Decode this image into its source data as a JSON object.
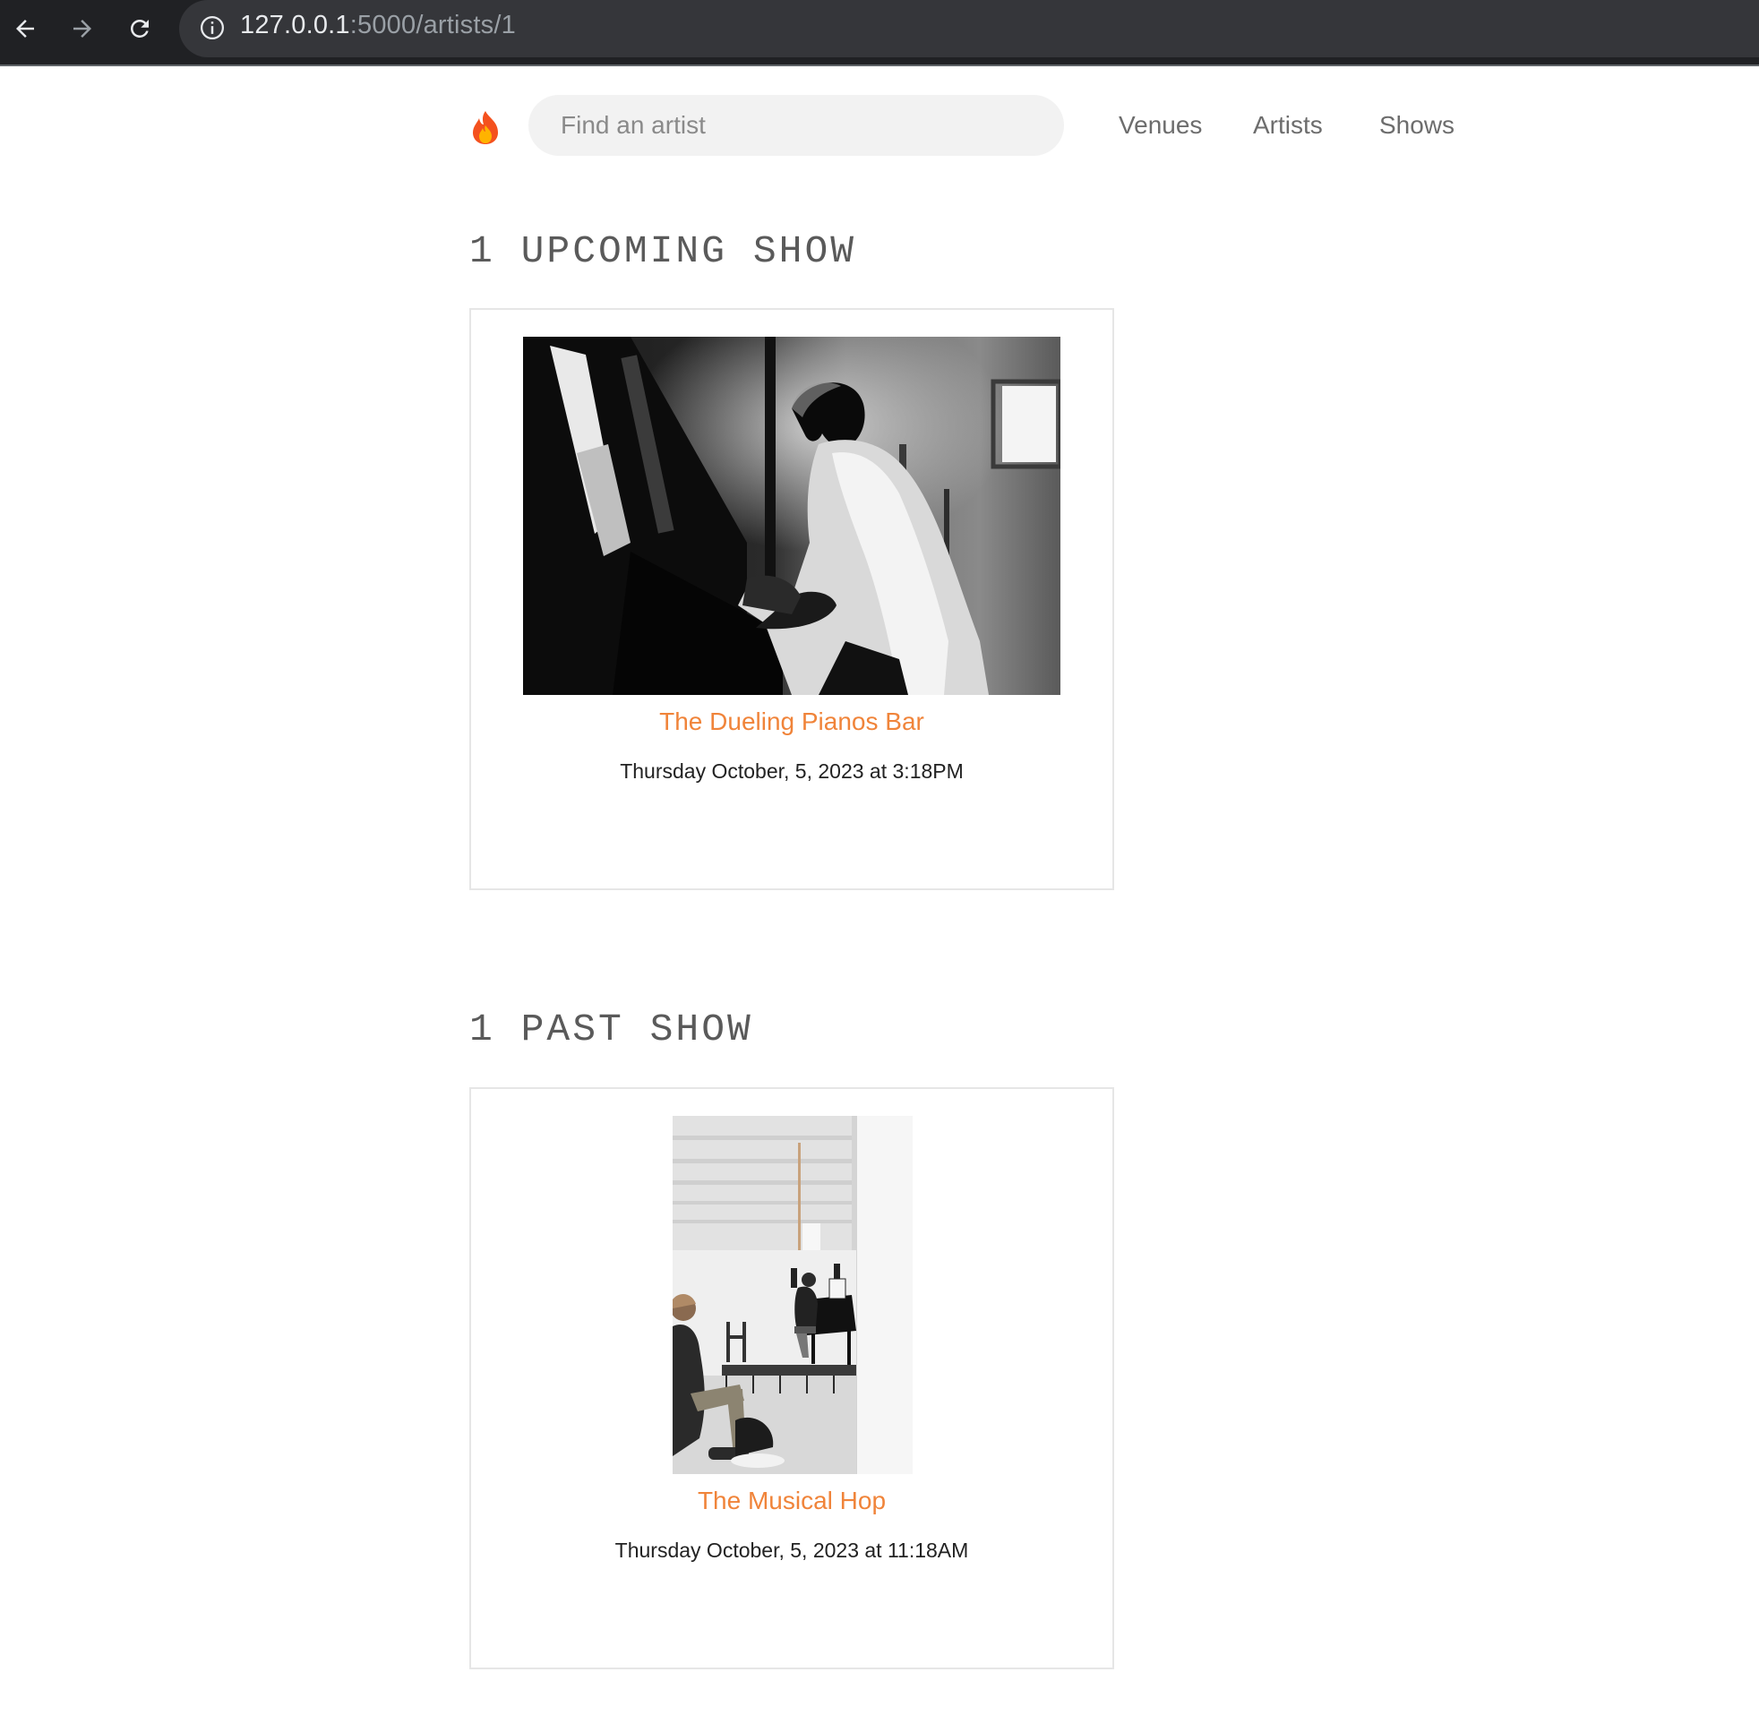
{
  "browser": {
    "url_host": "127.0.0.1",
    "url_path": ":5000/artists/1",
    "icons": [
      "back-arrow-icon",
      "forward-arrow-icon",
      "reload-icon",
      "info-icon"
    ]
  },
  "header": {
    "logo_icon": "flame-icon",
    "search_placeholder": "Find an artist",
    "nav": {
      "venues": "Venues",
      "artists": "Artists",
      "shows": "Shows"
    }
  },
  "upcoming": {
    "title": "1 UPCOMING SHOW",
    "shows": [
      {
        "venue": "The Dueling Pianos Bar",
        "time": "Thursday October, 5, 2023 at 3:18PM",
        "image": "black-and-white photo of a pianist playing an upright piano"
      }
    ]
  },
  "past": {
    "title": "1 PAST SHOW",
    "shows": [
      {
        "venue": "The Musical Hop",
        "time": "Thursday October, 5, 2023 at 11:18AM",
        "image": "photo of a pianist on a stage in a white warehouse with a seated spectator"
      }
    ]
  },
  "colors": {
    "accent": "#f0843a",
    "chrome": "#202124",
    "omnibox": "#35363a",
    "search_bg": "#f2f2f2",
    "card_border": "#e6e6e6"
  }
}
